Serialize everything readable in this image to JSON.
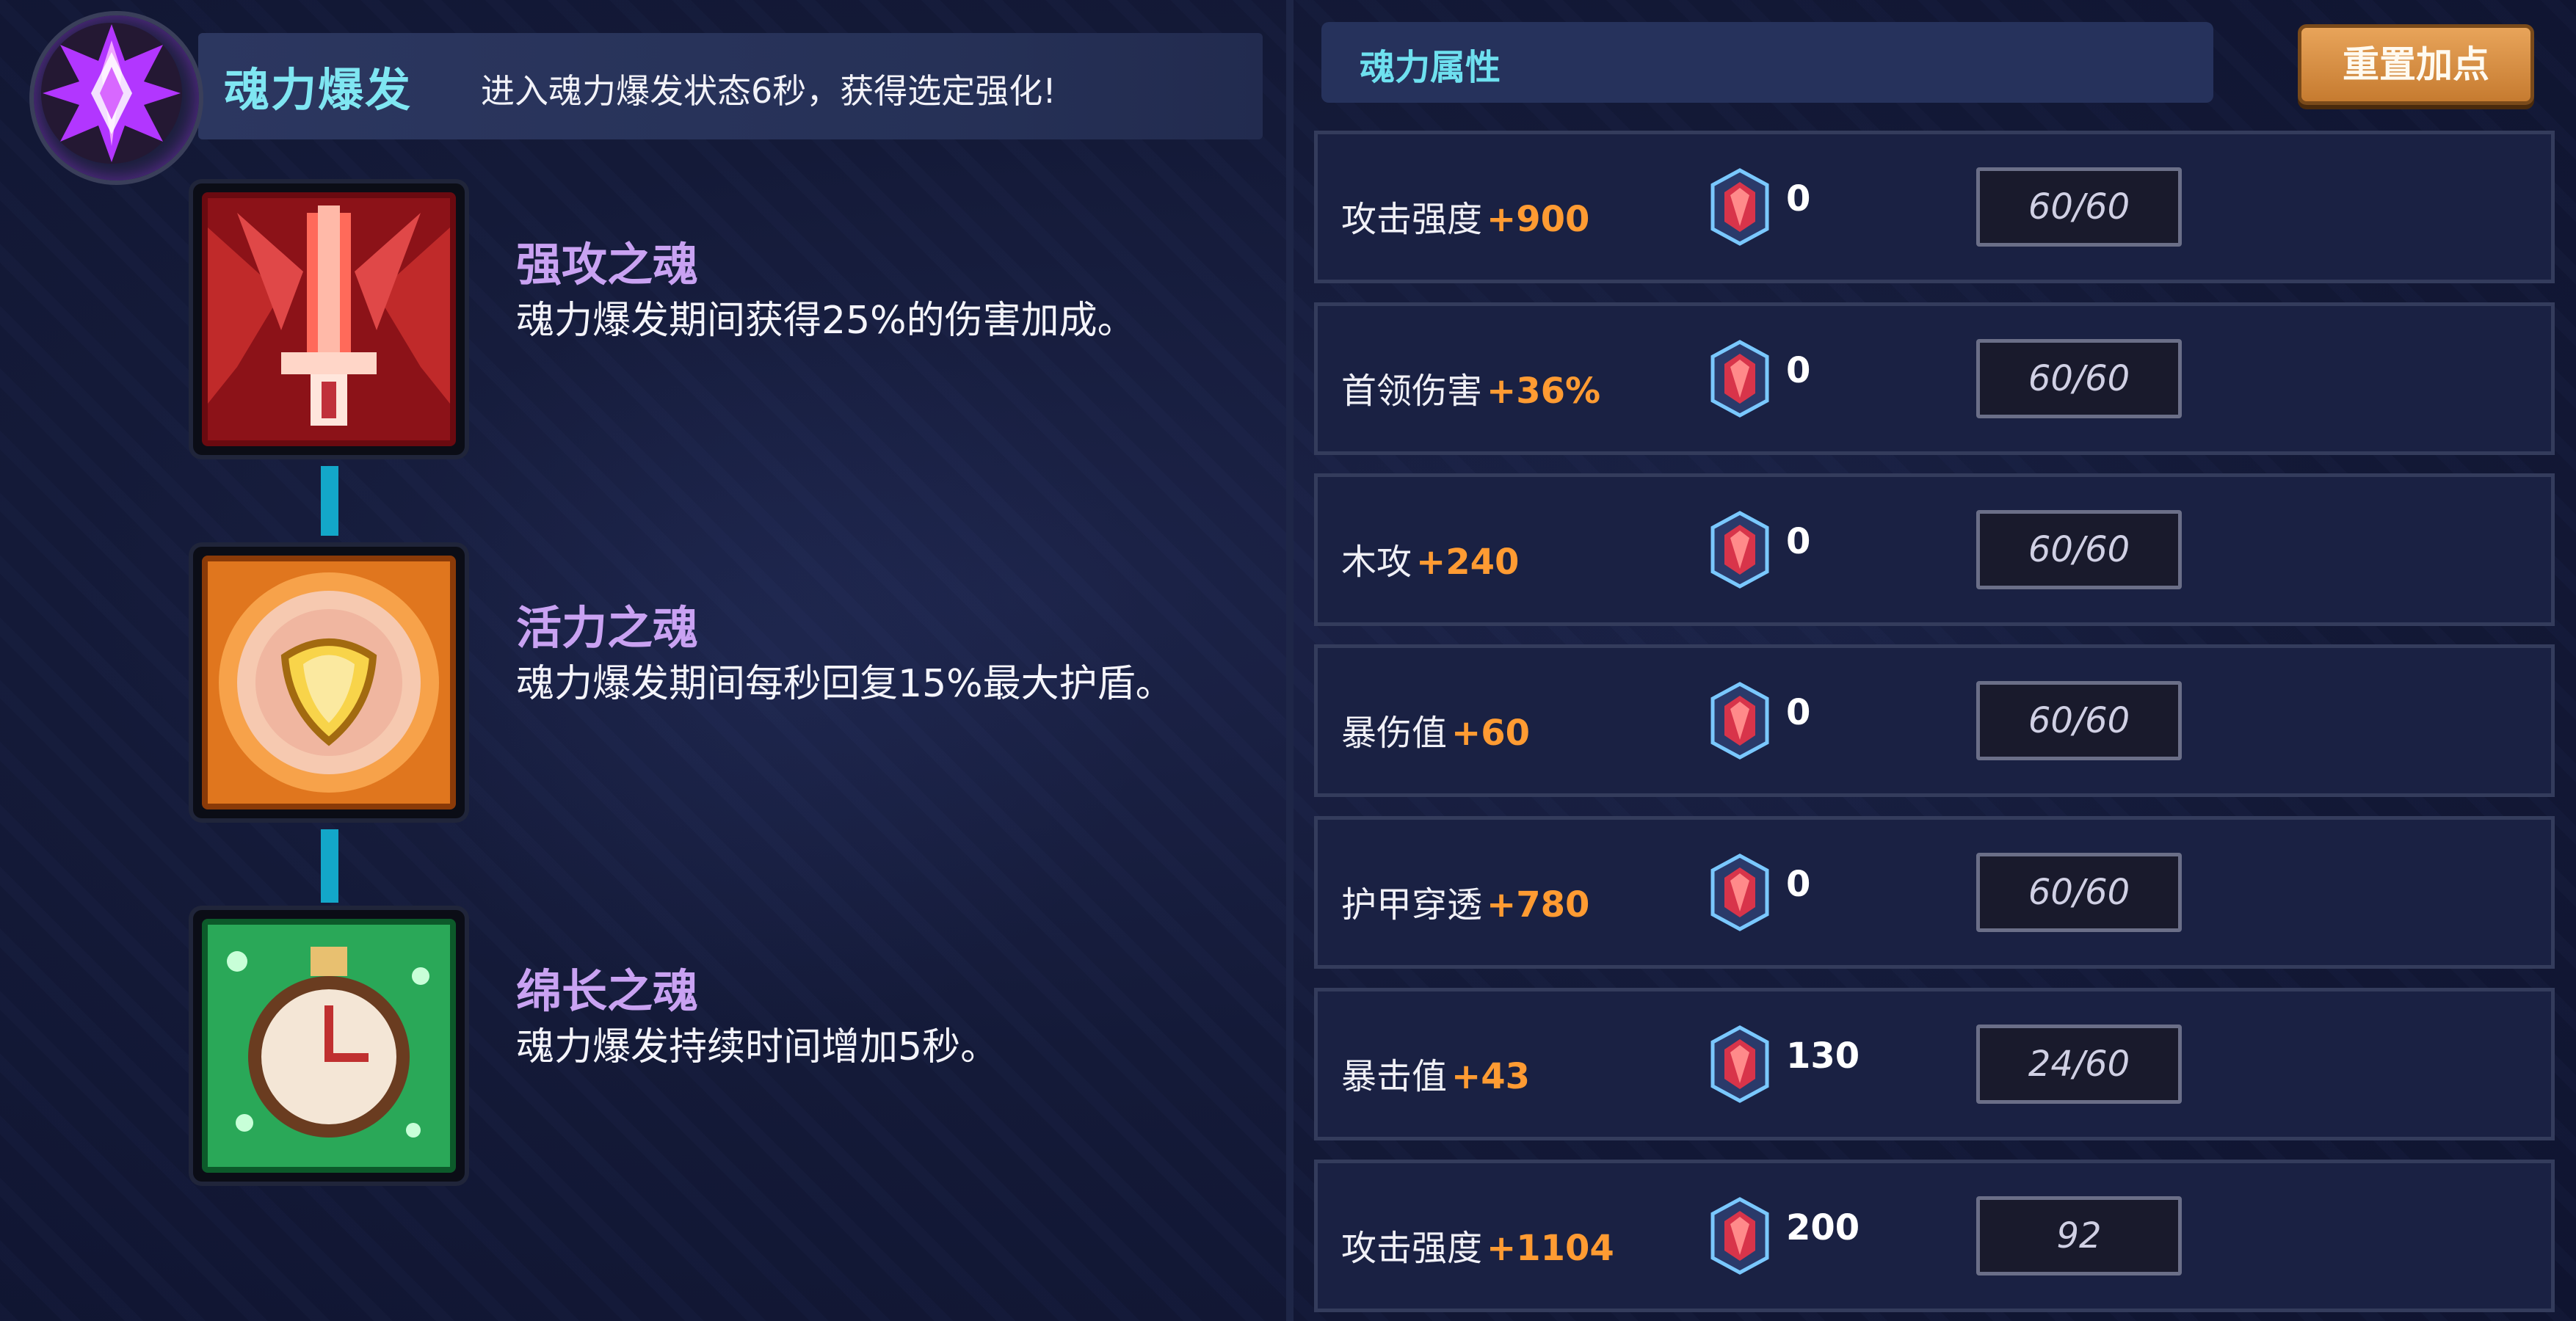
{
  "header": {
    "title": "魂力爆发",
    "description": "进入魂力爆发状态6秒，获得选定强化!"
  },
  "skills": [
    {
      "name": "强攻之魂",
      "description": "魂力爆发期间获得25%的伤害加成。",
      "icon": "red-sword-soul-icon"
    },
    {
      "name": "活力之魂",
      "description": "魂力爆发期间每秒回复15%最大护盾。",
      "icon": "orange-shield-soul-icon"
    },
    {
      "name": "绵长之魂",
      "description": "魂力爆发持续时间增加5秒。",
      "icon": "green-clock-soul-icon"
    }
  ],
  "attributes": {
    "title": "魂力属性",
    "reset_label": "重置加点",
    "rows": [
      {
        "label": "攻击强度",
        "bonus": "+900",
        "gems": "0",
        "level": "60/60"
      },
      {
        "label": "首领伤害",
        "bonus": "+36%",
        "gems": "0",
        "level": "60/60"
      },
      {
        "label": "木攻",
        "bonus": "+240",
        "gems": "0",
        "level": "60/60"
      },
      {
        "label": "暴伤值",
        "bonus": "+60",
        "gems": "0",
        "level": "60/60"
      },
      {
        "label": "护甲穿透",
        "bonus": "+780",
        "gems": "0",
        "level": "60/60"
      },
      {
        "label": "暴击值",
        "bonus": "+43",
        "gems": "130",
        "level": "24/60"
      },
      {
        "label": "攻击强度",
        "bonus": "+1104",
        "gems": "200",
        "level": "92"
      }
    ]
  },
  "colors": {
    "title_cyan": "#7fe6f2",
    "skill_name_purple": "#c9a2f2",
    "bonus_orange": "#ff9b32",
    "button_orange": "#d98b3e"
  }
}
